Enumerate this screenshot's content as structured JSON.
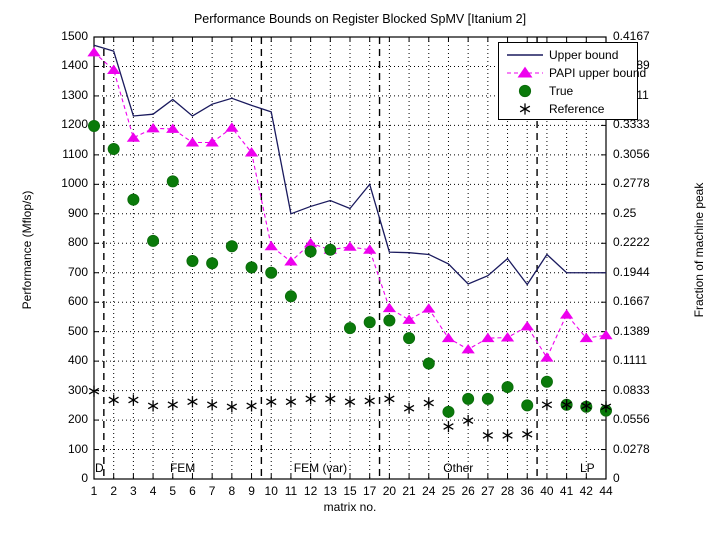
{
  "chart_data": {
    "type": "line",
    "title": "Performance Bounds on Register Blocked SpMV [Itanium 2]",
    "xlabel": "matrix no.",
    "ylabel": "Performance (Mflop/s)",
    "ylabel_right": "Fraction of machine peak",
    "categories": [
      "1",
      "2",
      "3",
      "4",
      "5",
      "6",
      "7",
      "8",
      "9",
      "10",
      "11",
      "12",
      "13",
      "15",
      "17",
      "20",
      "21",
      "24",
      "25",
      "26",
      "27",
      "28",
      "36",
      "40",
      "41",
      "42",
      "44"
    ],
    "ylim": [
      0,
      1500
    ],
    "yticks": [
      0,
      100,
      200,
      300,
      400,
      500,
      600,
      700,
      800,
      900,
      1000,
      1100,
      1200,
      1300,
      1400,
      1500
    ],
    "ylim_right": [
      0,
      0.4167
    ],
    "yticks_right": [
      "0",
      "0.0278",
      "0.0556",
      "0.0833",
      "0.1111",
      "0.1389",
      "0.1667",
      "0.1944",
      "0.2222",
      "0.25",
      "0.2778",
      "0.3056",
      "0.3333",
      "0.3611",
      "0.3889",
      "0.4167"
    ],
    "grid": true,
    "legend_position": "top-right",
    "series": [
      {
        "name": "Upper bound",
        "color": "#1a1a5e",
        "marker": "none",
        "style": "solid-line",
        "values": [
          1472,
          1452,
          1232,
          1238,
          1288,
          1232,
          1272,
          1292,
          1268,
          1246,
          900,
          925,
          945,
          918,
          1000,
          770,
          768,
          762,
          730,
          662,
          690,
          748,
          660,
          762,
          700,
          700,
          700
        ]
      },
      {
        "name": "PAPI upper bound",
        "color": "#ee00ee",
        "marker": "triangle",
        "style": "dashed-line",
        "values": [
          1448,
          1388,
          1158,
          1190,
          1188,
          1142,
          1142,
          1192,
          1108,
          790,
          738,
          800,
          778,
          788,
          778,
          580,
          540,
          578,
          478,
          440,
          478,
          480,
          518,
          412,
          558,
          478,
          488
        ]
      },
      {
        "name": "True",
        "color": "#0a7a0a",
        "marker": "circle",
        "style": "markers",
        "values": [
          1198,
          1120,
          948,
          808,
          1010,
          740,
          732,
          790,
          718,
          700,
          620,
          772,
          778,
          512,
          532,
          538,
          478,
          392,
          228,
          272,
          272,
          312,
          250,
          330,
          252,
          245,
          232
        ]
      },
      {
        "name": "Reference",
        "color": "#000000",
        "marker": "asterisk",
        "style": "markers",
        "values": [
          298,
          268,
          268,
          248,
          252,
          262,
          252,
          245,
          248,
          262,
          262,
          272,
          272,
          262,
          265,
          272,
          240,
          258,
          178,
          198,
          148,
          148,
          152,
          252,
          252,
          248,
          245
        ]
      }
    ],
    "group_labels": [
      {
        "text": "D",
        "index_start": 0,
        "index_end": 0
      },
      {
        "text": "FEM",
        "index_start": 1,
        "index_end": 8
      },
      {
        "text": "FEM (var)",
        "index_start": 9,
        "index_end": 14
      },
      {
        "text": "Other",
        "index_start": 15,
        "index_end": 22
      },
      {
        "text": "LP",
        "index_start": 23,
        "index_end": 26
      }
    ],
    "dividers": [
      0.5,
      8.5,
      14.5,
      22.5
    ]
  }
}
